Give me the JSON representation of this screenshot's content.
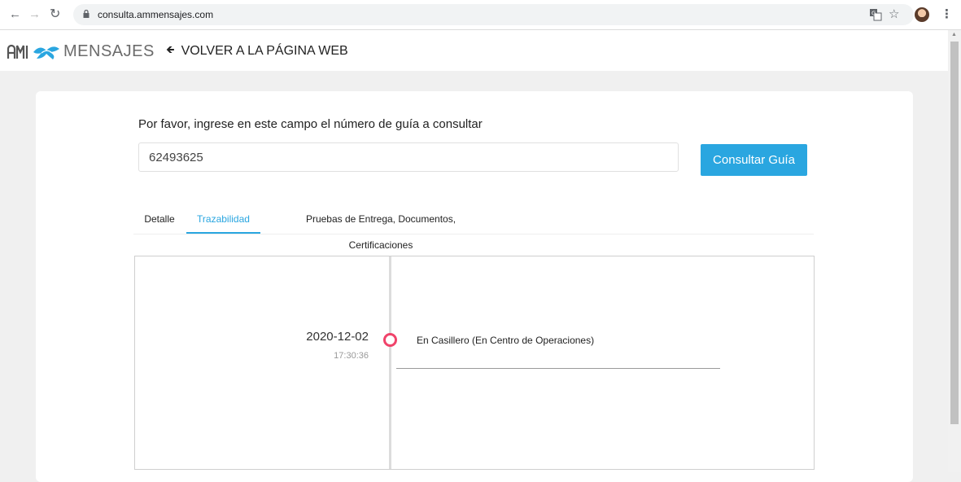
{
  "browser": {
    "url": "consulta.ammensajes.com"
  },
  "header": {
    "logo_text": "MENSAJES",
    "back_link": "VOLVER A LA PÁGINA WEB"
  },
  "form": {
    "prompt": "Por favor, ingrese en este campo el número de guía a consultar",
    "guide_number": "62493625",
    "submit_label": "Consultar Guía"
  },
  "tabs": [
    {
      "label": "Detalle",
      "active": false
    },
    {
      "label": "Trazabilidad",
      "active": true
    },
    {
      "label": "Pruebas de Entrega, Documentos, Certificaciones",
      "active": false
    }
  ],
  "timeline": {
    "events": [
      {
        "date": "2020-12-02",
        "time": "17:30:36",
        "description": "En Casillero (En Centro de Operaciones)"
      }
    ]
  },
  "colors": {
    "accent": "#2aa6e0",
    "marker": "#f0436a",
    "page_background": "#f0f0f0"
  },
  "icons": [
    "back-icon",
    "forward-icon",
    "reload-icon",
    "lock-icon",
    "translate-icon",
    "star-icon",
    "menu-icon",
    "arrow-left-icon"
  ]
}
